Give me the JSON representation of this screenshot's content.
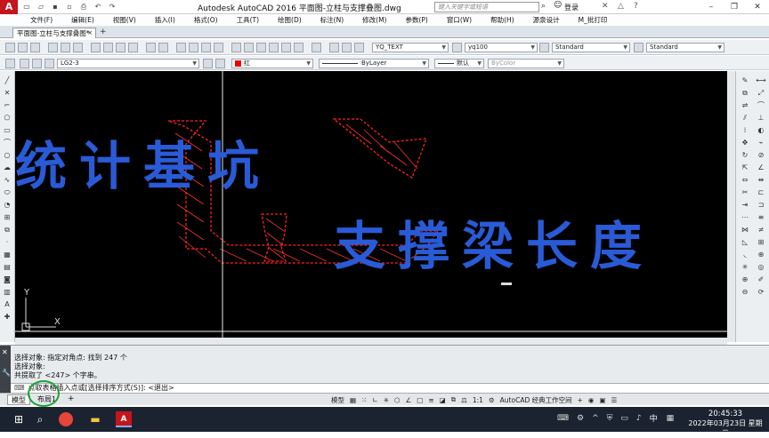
{
  "titlebar": {
    "logo": "A",
    "title": "Autodesk AutoCAD 2016    平面图-立柱与支撑叠图.dwg",
    "search_placeholder": "键入关键字或短语",
    "login": "登录"
  },
  "menu": {
    "items": [
      "文件(F)",
      "编辑(E)",
      "视图(V)",
      "插入(I)",
      "格式(O)",
      "工具(T)",
      "绘图(D)",
      "标注(N)",
      "修改(M)",
      "参数(P)",
      "窗口(W)",
      "帮助(H)",
      "源泉设计",
      "M_批打印"
    ]
  },
  "document_tab": {
    "label": "平面图-立柱与支撑叠图*",
    "close": "×",
    "new_tab": "+"
  },
  "toolbar": {
    "text_style": "YQ_TEXT",
    "dim_style": "yq100",
    "table_style": "Standard",
    "multileader_style": "Standard",
    "layer": "LG2-3",
    "color": "红",
    "linetype": "ByLayer",
    "lineweight": "默认",
    "plot_style": "ByColor"
  },
  "overlay": {
    "line1": "统计基坑",
    "line2": "支撑梁长度"
  },
  "ucs": {
    "y_label": "Y",
    "x_label": "X"
  },
  "command": {
    "history": [
      "选择对象: 指定对角点: 找到 247 个",
      "选择对象:",
      "共提取了 <247> 个字串。"
    ],
    "prompt_prefix": "⌨",
    "prompt": "点取表格插入点或[选择排序方式(S)]: <退出>"
  },
  "layout": {
    "model": "模型",
    "layout1": "布局1",
    "add": "+"
  },
  "status": {
    "model": "模型",
    "scale": "1:1",
    "workspace": "AutoCAD 经典工作空间"
  },
  "taskbar": {
    "time": "20:45:33",
    "date": "2022年03月23日 星期三",
    "lang": "中"
  },
  "colors": {
    "overlay_text": "#2a5bd7",
    "drawing_red": "#ff2020",
    "canvas_bg": "#000000",
    "highlight_circle": "#1ca33a"
  }
}
